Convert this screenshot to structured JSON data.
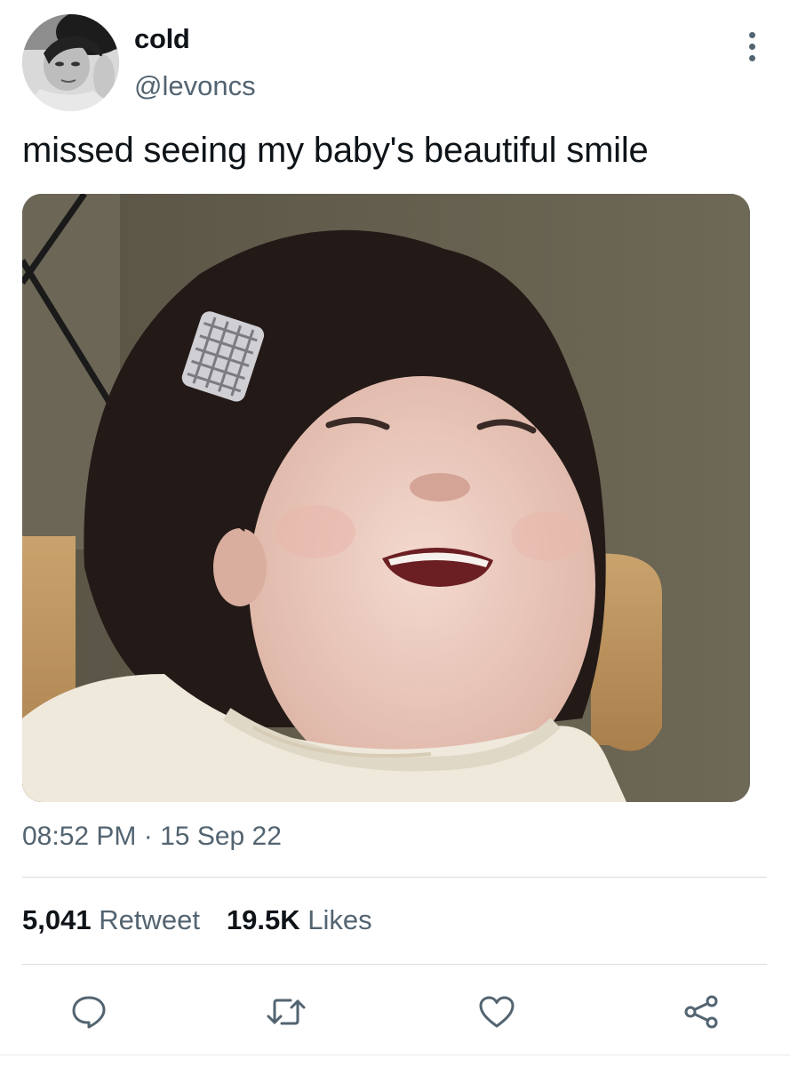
{
  "tweet": {
    "author": {
      "name": "cold",
      "handle": "@levoncs"
    },
    "text": "missed seeing my baby's beautiful smile",
    "time": "08:52 PM",
    "separator": "·",
    "date": "15 Sep 22",
    "stats": {
      "retweets_count": "5,041",
      "retweets_label": "Retweet",
      "likes_count": "19.5K",
      "likes_label": "Likes"
    }
  },
  "icons": {
    "more": "more-vertical-icon",
    "reply": "comment-icon",
    "retweet": "retweet-icon",
    "like": "heart-icon",
    "share": "share-icon"
  },
  "colors": {
    "text": "#0f1419",
    "secondary": "#536471",
    "divider": "#d7dde2"
  }
}
